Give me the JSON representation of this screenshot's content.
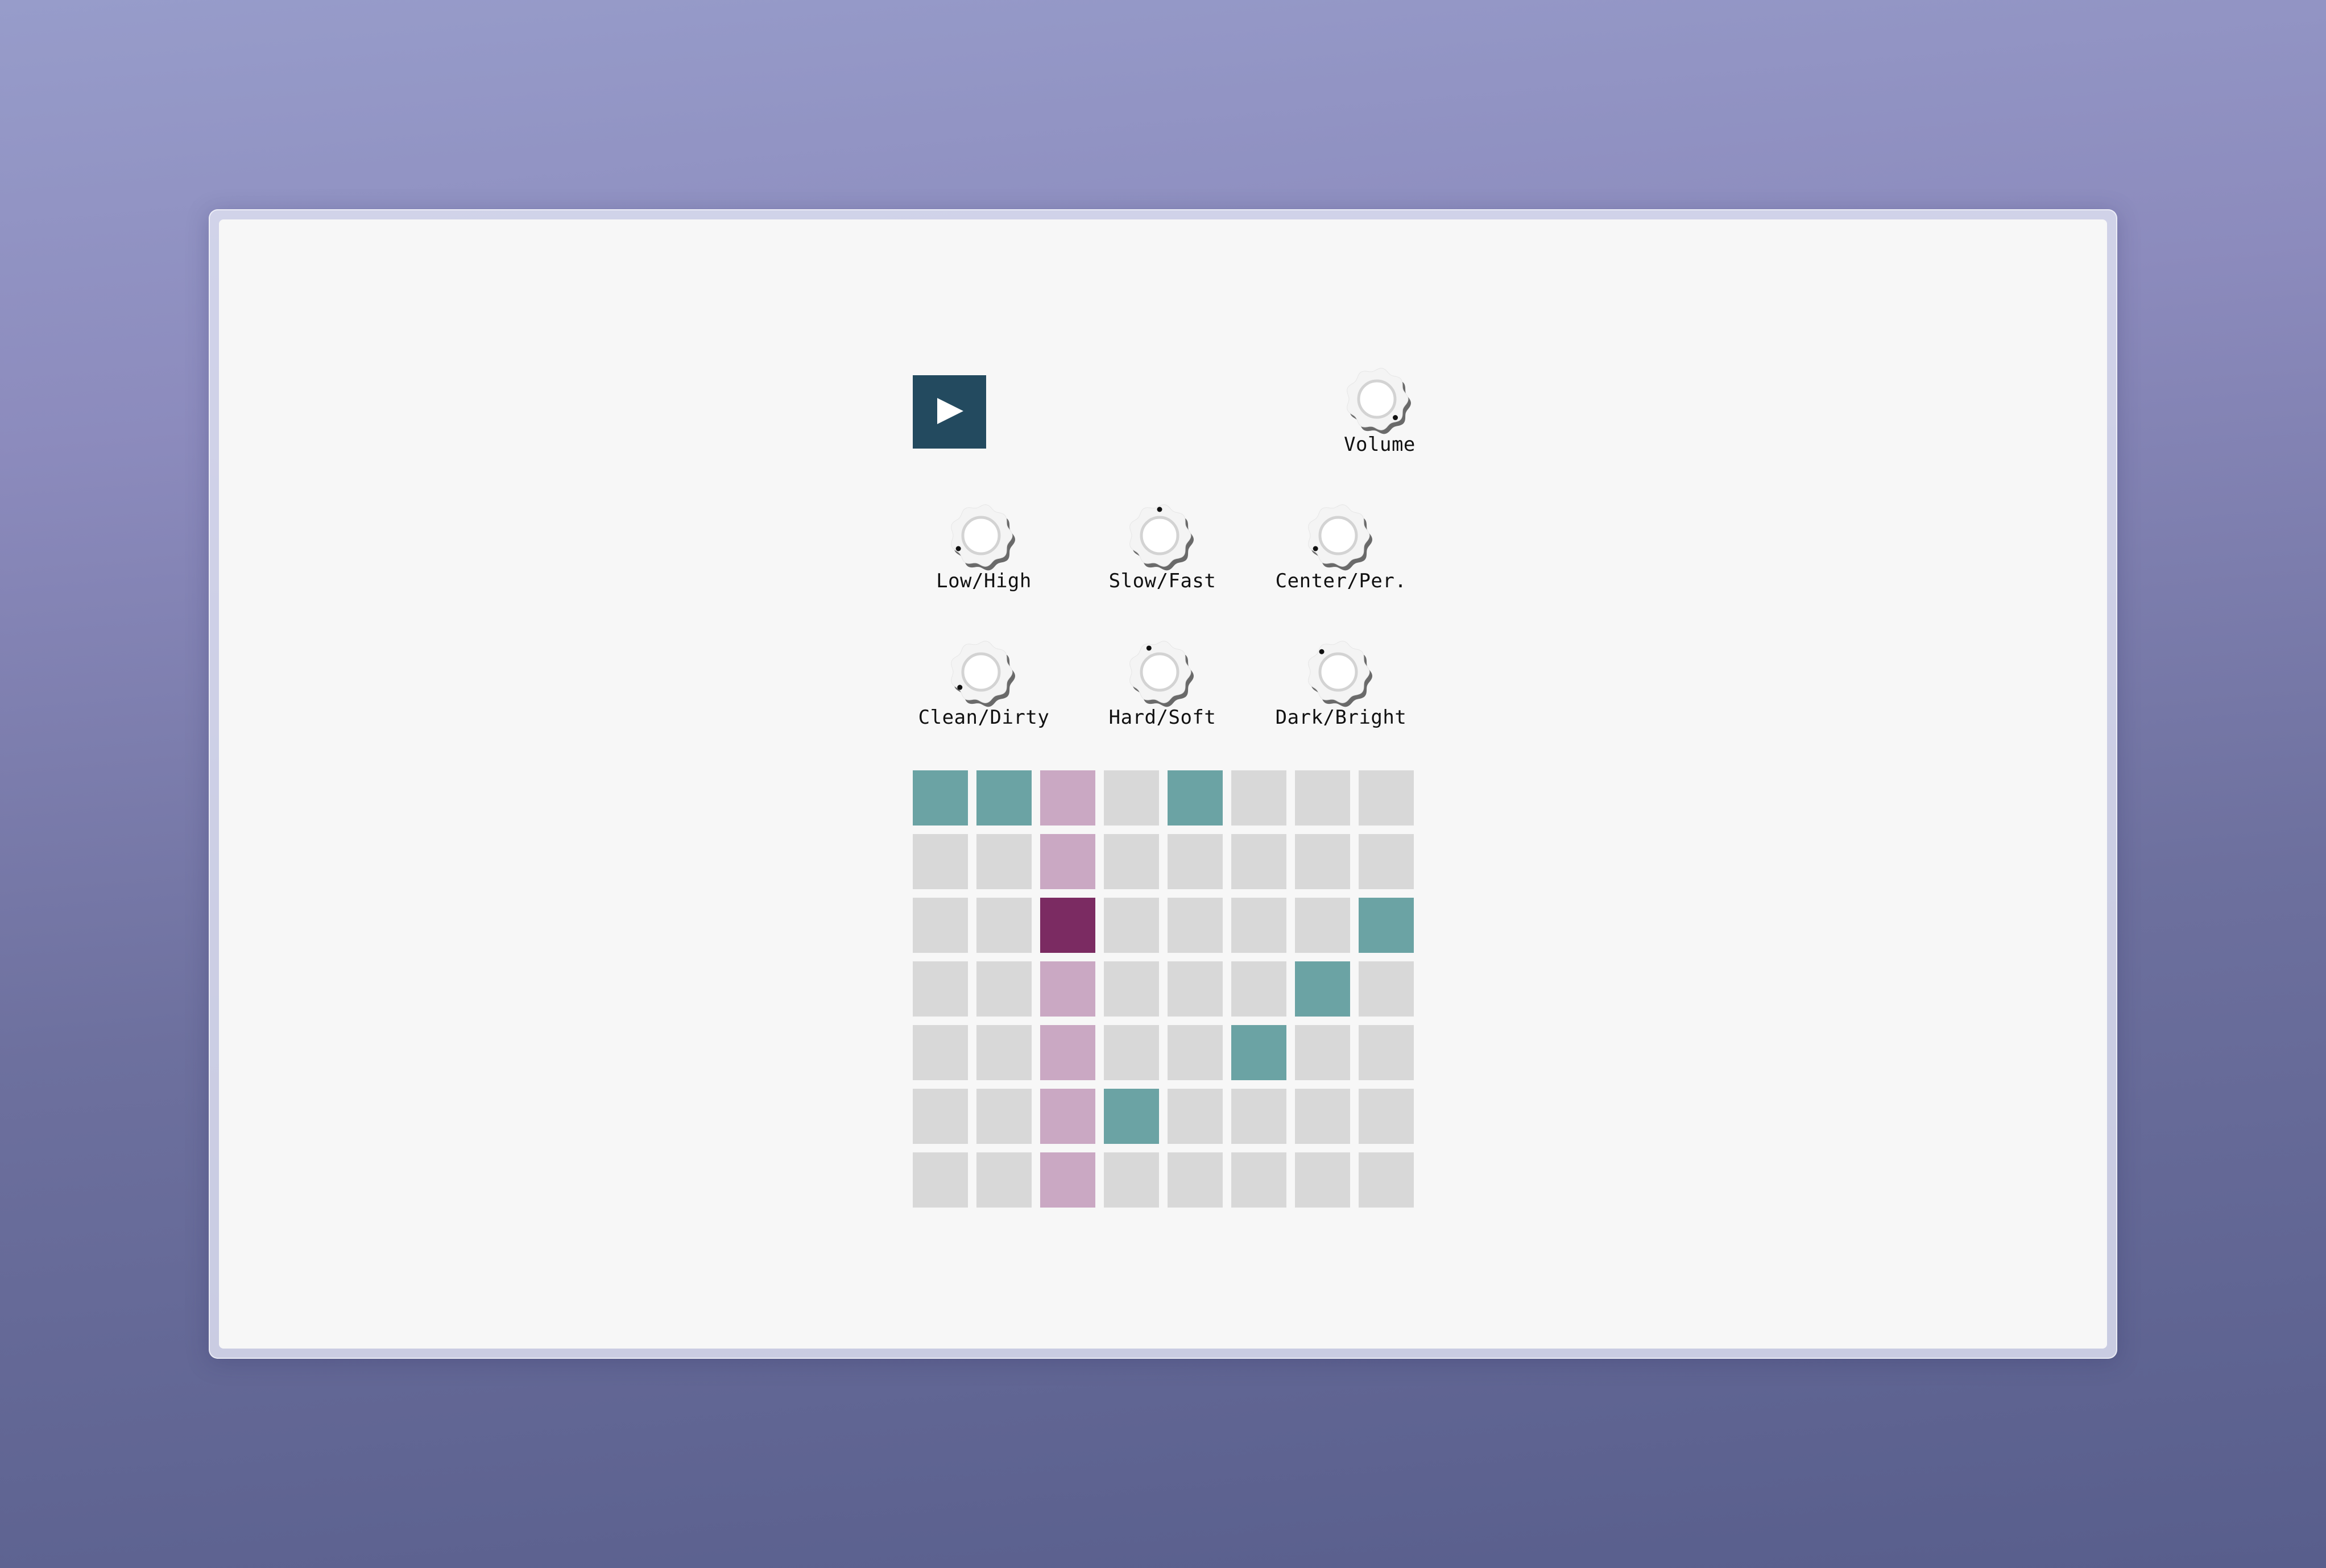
{
  "controls": {
    "play_icon": "play-icon",
    "play_symbol": "▶"
  },
  "knobs": [
    {
      "id": "volume",
      "label": "Volume",
      "value": 0.95
    },
    {
      "id": "low-high",
      "label": "Low/High",
      "value": 0.1
    },
    {
      "id": "slow-fast",
      "label": "Slow/Fast",
      "value": 0.5
    },
    {
      "id": "center-per",
      "label": "Center/Per.",
      "value": 0.1
    },
    {
      "id": "clean-dirty",
      "label": "Clean/Dirty",
      "value": 0.08
    },
    {
      "id": "hard-soft",
      "label": "Hard/Soft",
      "value": 0.42
    },
    {
      "id": "dark-bright",
      "label": "Dark/Bright",
      "value": 0.37
    }
  ],
  "sequencer": {
    "columns": 8,
    "rows": 7,
    "playhead_column": 2,
    "colors": {
      "off": "#d8d8d8",
      "on": "#6ba3a4",
      "playhead": "#caa8c3",
      "playhead_on": "#7b2b62"
    },
    "active": [
      [
        0,
        0
      ],
      [
        1,
        0
      ],
      [
        4,
        0
      ],
      [
        2,
        2
      ],
      [
        7,
        2
      ],
      [
        6,
        3
      ],
      [
        5,
        4
      ],
      [
        3,
        5
      ]
    ]
  }
}
